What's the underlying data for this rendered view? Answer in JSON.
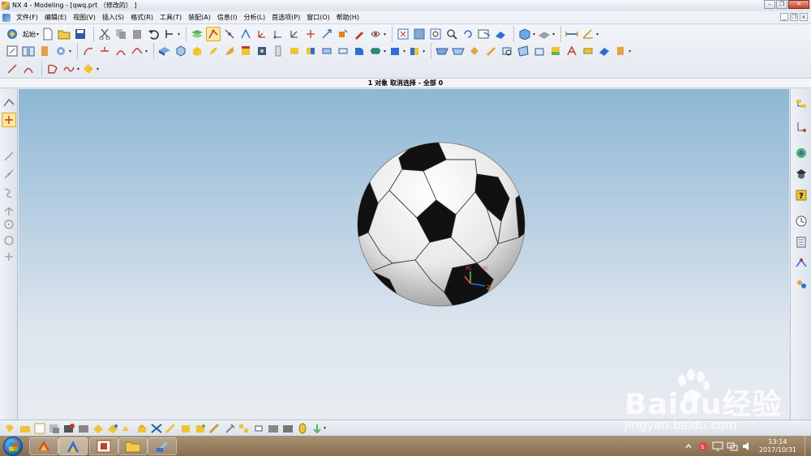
{
  "window": {
    "title": "NX 4 - Modeling - [qwq.prt （修改的） ]"
  },
  "menu": [
    "文件(F)",
    "编辑(E)",
    "视图(V)",
    "插入(S)",
    "格式(R)",
    "工具(T)",
    "装配(A)",
    "信息(I)",
    "分析(L)",
    "首选项(P)",
    "窗口(O)",
    "帮助(H)"
  ],
  "toolbar": {
    "start_label": "起始"
  },
  "status": {
    "text": "1 对象 取消选择 - 全部 0"
  },
  "taskbar": {
    "time": "13:14",
    "date": "2017/10/31"
  },
  "watermark": {
    "main": "Baidu经验",
    "sub": "jingyan.baidu.com"
  },
  "colors": {
    "viewport_top": "#8db7d4",
    "viewport_bottom": "#e8ecf1",
    "highlight": "#ffe79c"
  }
}
